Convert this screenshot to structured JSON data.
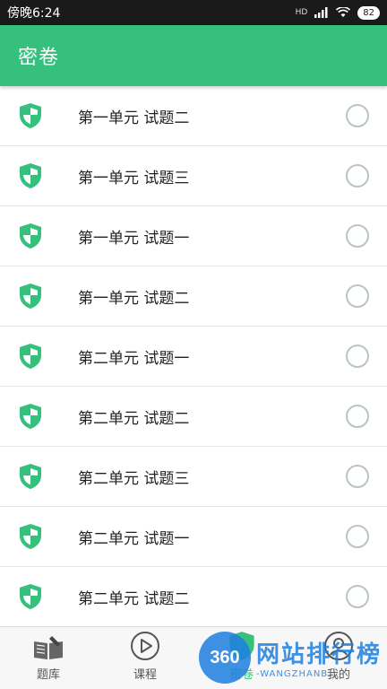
{
  "status_bar": {
    "time": "傍晚6:24",
    "signal": "HD",
    "battery": "82"
  },
  "header": {
    "title": "密卷"
  },
  "list": {
    "items": [
      {
        "label": "第一单元 试题二",
        "icon": "shield-icon"
      },
      {
        "label": "第一单元 试题三",
        "icon": "shield-icon"
      },
      {
        "label": "第一单元 试题一",
        "icon": "shield-icon"
      },
      {
        "label": "第一单元 试题二",
        "icon": "shield-icon"
      },
      {
        "label": "第二单元 试题一",
        "icon": "shield-icon"
      },
      {
        "label": "第二单元 试题二",
        "icon": "shield-icon"
      },
      {
        "label": "第二单元 试题三",
        "icon": "shield-icon"
      },
      {
        "label": "第二单元 试题一",
        "icon": "shield-icon"
      },
      {
        "label": "第二单元 试题二",
        "icon": "shield-icon"
      }
    ]
  },
  "tabs": [
    {
      "label": "题库",
      "icon": "book-pen-icon"
    },
    {
      "label": "课程",
      "icon": "play-circle-icon"
    },
    {
      "label": "密卷",
      "icon": "shield-icon"
    },
    {
      "label": "我的",
      "icon": "user-circle-icon"
    }
  ],
  "watermark": {
    "logo": "360",
    "title": "网站排行榜",
    "subtitle": "-WANGZHANB..."
  },
  "colors": {
    "accent": "#35c07e",
    "radio_border": "#b9c4c4",
    "status_bar": "#1a1a1a"
  }
}
